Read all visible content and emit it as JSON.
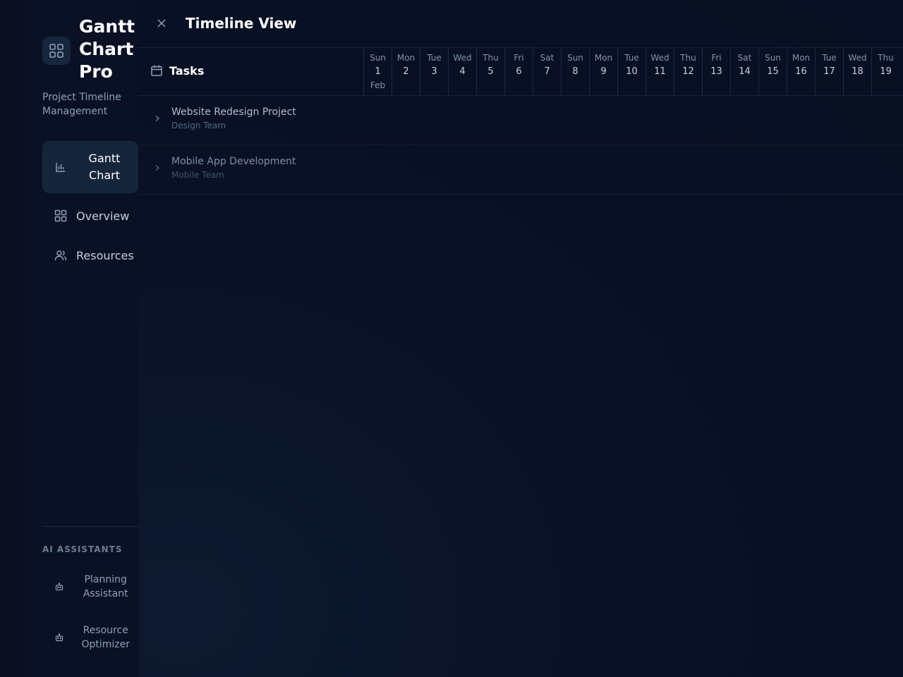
{
  "brand": {
    "name": "Gantt Chart Pro",
    "subtitle": "Project Timeline Management"
  },
  "nav": {
    "items": [
      {
        "label": "Gantt Chart",
        "icon": "bar-chart-icon",
        "active": true
      },
      {
        "label": "Overview",
        "icon": "grid-icon",
        "active": false
      },
      {
        "label": "Resources",
        "icon": "users-icon",
        "active": false
      }
    ]
  },
  "ai": {
    "title": "AI ASSISTANTS",
    "items": [
      {
        "label": "Planning Assistant",
        "icon": "bot-icon"
      },
      {
        "label": "Resource Optimizer",
        "icon": "bot-icon"
      }
    ]
  },
  "header": {
    "title": "Timeline View",
    "tasks_label": "Tasks"
  },
  "timeline": {
    "month": "Feb",
    "days": [
      {
        "dow": "Sun",
        "num": "1"
      },
      {
        "dow": "Mon",
        "num": "2"
      },
      {
        "dow": "Tue",
        "num": "3"
      },
      {
        "dow": "Wed",
        "num": "4"
      },
      {
        "dow": "Thu",
        "num": "5"
      },
      {
        "dow": "Fri",
        "num": "6"
      },
      {
        "dow": "Sat",
        "num": "7"
      },
      {
        "dow": "Sun",
        "num": "8"
      },
      {
        "dow": "Mon",
        "num": "9"
      },
      {
        "dow": "Tue",
        "num": "10"
      },
      {
        "dow": "Wed",
        "num": "11"
      },
      {
        "dow": "Thu",
        "num": "12"
      },
      {
        "dow": "Fri",
        "num": "13"
      },
      {
        "dow": "Sat",
        "num": "14"
      },
      {
        "dow": "Sun",
        "num": "15"
      },
      {
        "dow": "Mon",
        "num": "16"
      },
      {
        "dow": "Tue",
        "num": "17"
      },
      {
        "dow": "Wed",
        "num": "18"
      },
      {
        "dow": "Thu",
        "num": "19"
      }
    ]
  },
  "tasks": [
    {
      "name": "Website Redesign Project",
      "team": "Design Team"
    },
    {
      "name": "Mobile App Development",
      "team": "Mobile Team"
    }
  ],
  "colors": {
    "background": "#0b1226",
    "sidebar_active": "#15263b",
    "accent_text": "#ffffff",
    "muted_text": "#8ea0b8"
  }
}
